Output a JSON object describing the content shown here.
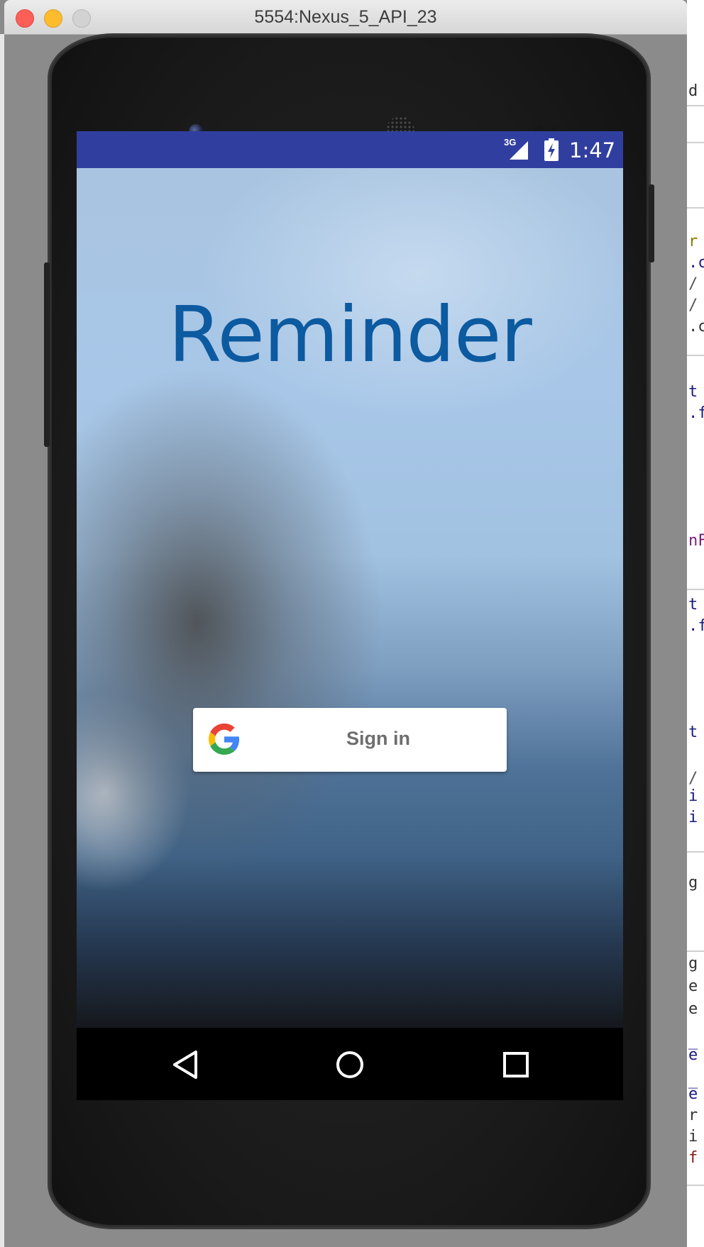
{
  "window": {
    "title": "5554:Nexus_5_API_23"
  },
  "status_bar": {
    "network": "3G",
    "time": "1:47",
    "color": "#303f9f"
  },
  "app": {
    "title": "Reminder",
    "title_color": "#0c5aa0"
  },
  "sign_in": {
    "label": "Sign in",
    "icon": "google-g-icon"
  },
  "nav_bar": {
    "buttons": [
      "back-icon",
      "home-icon",
      "recents-icon"
    ]
  },
  "ide_background": {
    "fragments": [
      "d",
      "r",
      ".c",
      "/",
      "/",
      ".c",
      "t",
      ".f",
      "nF",
      "t",
      ".f",
      "t",
      "/",
      "i",
      "i",
      "g",
      "g",
      "e",
      "e",
      "_",
      "e",
      "_",
      "e",
      "r",
      "i",
      "f"
    ]
  }
}
